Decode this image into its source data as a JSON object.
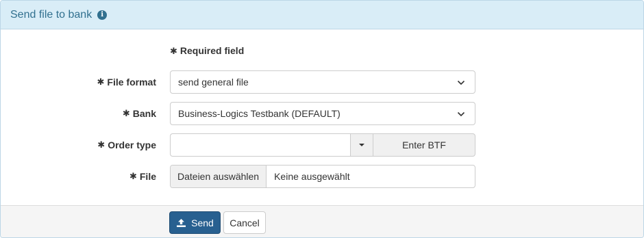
{
  "header": {
    "title": "Send file to bank",
    "info_icon": "info-icon"
  },
  "form": {
    "required_note": "Required field",
    "required_marker": "✱",
    "file_format": {
      "label": "File format",
      "value": "send general file"
    },
    "bank": {
      "label": "Bank",
      "value": "Business-Logics Testbank (DEFAULT)"
    },
    "order_type": {
      "label": "Order type",
      "value": "",
      "button_label": "Enter BTF"
    },
    "file": {
      "label": "File",
      "button_label": "Dateien auswählen",
      "status": "Keine ausgewählt"
    }
  },
  "footer": {
    "send_label": "Send",
    "cancel_label": "Cancel",
    "send_icon": "upload-icon"
  },
  "colors": {
    "header_bg": "#d9edf7",
    "header_text": "#31708f",
    "primary": "#286090"
  }
}
